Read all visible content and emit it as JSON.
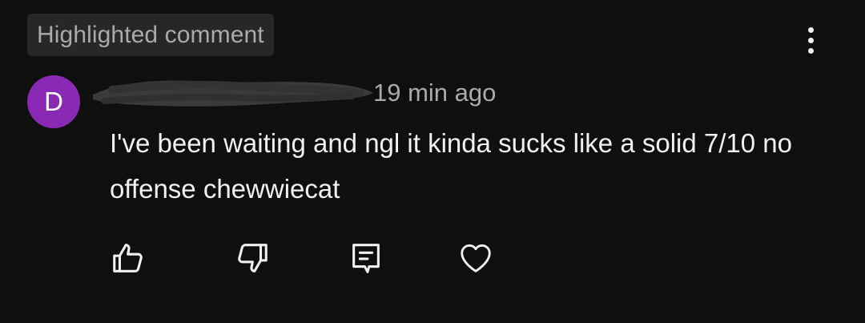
{
  "badge": {
    "label": "Highlighted comment"
  },
  "menu": {
    "icon": "more-vert-icon"
  },
  "comment": {
    "avatar_letter": "D",
    "avatar_color": "#8a2ab4",
    "time": "19 min ago",
    "text": "I've been waiting and ngl it kinda sucks like a solid 7/10 no offense chewwiecat"
  },
  "actions": [
    {
      "icon": "thumbs-up-icon"
    },
    {
      "icon": "thumbs-down-icon"
    },
    {
      "icon": "reply-comment-icon"
    },
    {
      "icon": "heart-icon"
    }
  ]
}
